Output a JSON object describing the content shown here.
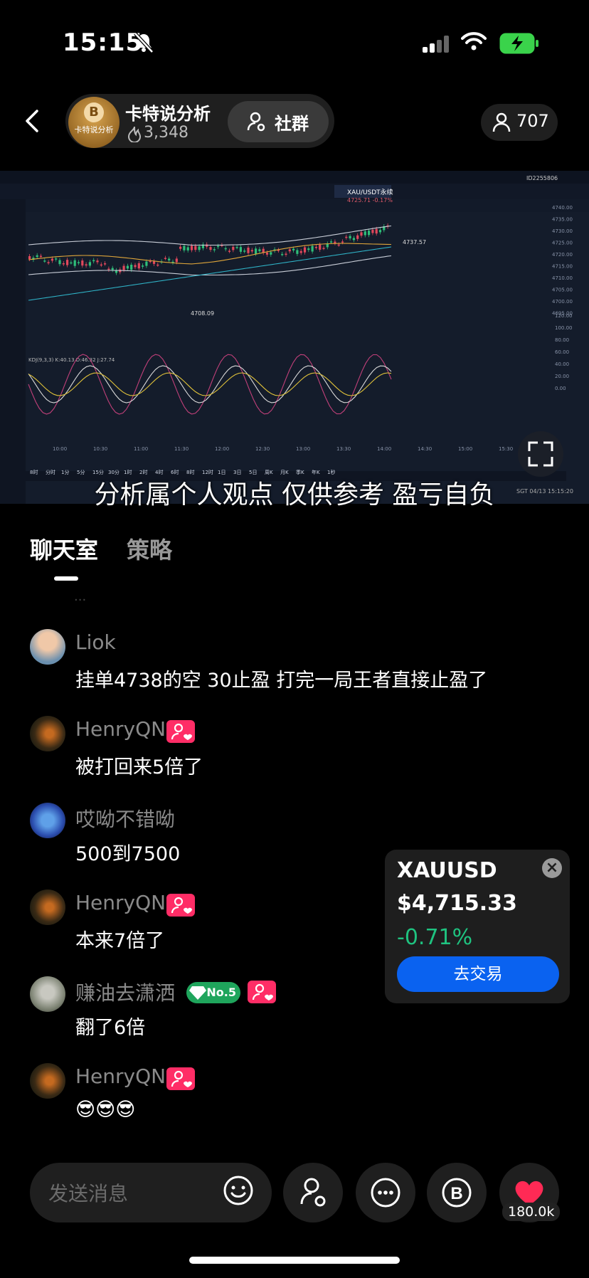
{
  "status_bar": {
    "time": "15:15"
  },
  "header": {
    "host_name": "卡特说分析",
    "host_heat": "3,348",
    "avatar_text": "卡特说分析",
    "group_label": "社群",
    "viewer_count": "707"
  },
  "video": {
    "caption": "分析属个人观点 仅供参考 盈亏自负",
    "screen": {
      "tab_active": "XAU/USDT永续",
      "header_price": "4725.71 -0.17%",
      "high_label": "4737.57",
      "low_label": "4708.09",
      "indicator_label": "KDJ(9,3,3) K:40.13 D:46.32 J:27.74",
      "account_id": "ID2255806",
      "intervals": [
        "8时",
        "分时",
        "1分",
        "5分",
        "15分",
        "30分",
        "1时",
        "2时",
        "4时",
        "6时",
        "8时",
        "12时",
        "1日",
        "3日",
        "5日",
        "周K",
        "月K",
        "季K",
        "年K",
        "1秒"
      ],
      "time_ticks": [
        "10:00",
        "10:30",
        "11:00",
        "11:30",
        "12:00",
        "12:30",
        "13:00",
        "13:30",
        "14:00",
        "14:30",
        "15:00",
        "15:30"
      ],
      "price_ticks": [
        "4740.00",
        "4735.00",
        "4730.00",
        "4725.00",
        "4720.00",
        "4715.00",
        "4710.00",
        "4705.00",
        "4700.00",
        "4695.00"
      ],
      "osc_ticks": [
        "120.00",
        "100.00",
        "80.00",
        "60.00",
        "40.00",
        "20.00",
        "0.00"
      ],
      "sgt_time": "SGT 04/13 15:15:20"
    }
  },
  "tabs": {
    "chat": "聊天室",
    "strategy": "策略"
  },
  "chat": {
    "faded_line": "...",
    "messages": [
      {
        "user": "Liok",
        "text": "挂单4738的空  30止盈 打完一局王者直接止盈了"
      },
      {
        "user": "HenryQN",
        "text": "被打回来5倍了"
      },
      {
        "user": "哎呦不错呦",
        "text": "500到7500"
      },
      {
        "user": "HenryQN",
        "text": "本来7倍了"
      },
      {
        "user": "赚油去潇洒",
        "badge": "No.5",
        "text": "翻了6倍"
      },
      {
        "user": "HenryQN",
        "text": "😎😎😎"
      }
    ]
  },
  "ticker": {
    "symbol": "XAUUSD",
    "price": "$4,715.33",
    "change": "-0.71%",
    "button": "去交易",
    "change_color": "#1fc380",
    "button_color": "#0a62f0"
  },
  "bottom": {
    "input_placeholder": "发送消息",
    "like_count": "180.0k"
  },
  "icons": [
    "bell-off-icon",
    "signal-icon",
    "wifi-icon",
    "battery-charging-icon",
    "back-icon",
    "flame-icon",
    "group-user-icon",
    "person-icon",
    "fullscreen-icon",
    "emoji-icon",
    "link-user-icon",
    "more-icon",
    "b-coin-icon",
    "heart-icon",
    "close-icon"
  ]
}
